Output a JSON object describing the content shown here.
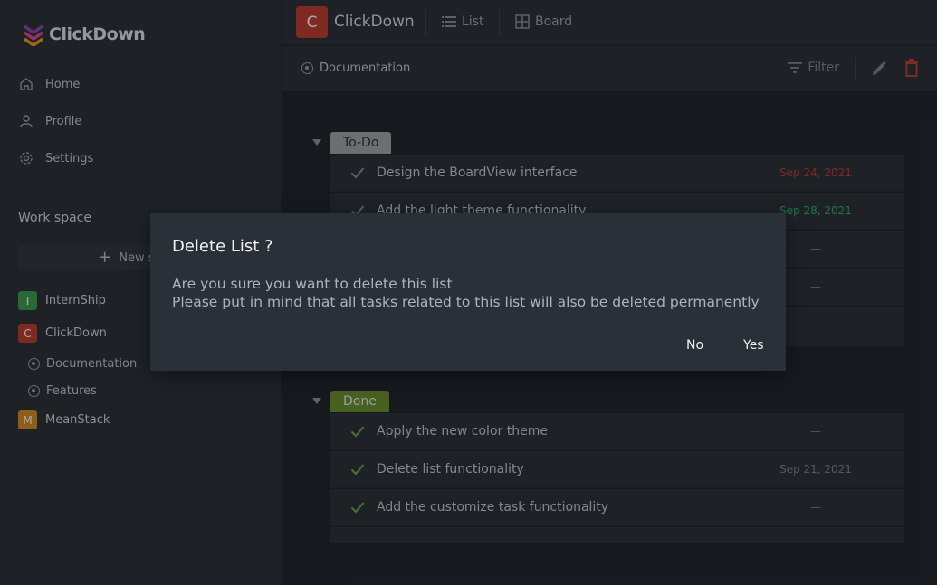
{
  "app": {
    "name": "ClickDown"
  },
  "sidebar": {
    "nav": [
      {
        "label": "Home",
        "icon": "home-icon"
      },
      {
        "label": "Profile",
        "icon": "user-icon"
      },
      {
        "label": "Settings",
        "icon": "gear-icon"
      }
    ],
    "workspace_title": "Work space",
    "new_space_label": "New space",
    "spaces": [
      {
        "letter": "I",
        "name": "InternShip",
        "color": "#3d9a4a"
      },
      {
        "letter": "C",
        "name": "ClickDown",
        "color": "#c0392b"
      },
      {
        "letter": "M",
        "name": "MeanStack",
        "color": "#d68a1f"
      }
    ],
    "lists": [
      "Documentation",
      "Features"
    ]
  },
  "topbar": {
    "project_letter": "C",
    "project_name": "ClickDown",
    "tabs": [
      "List",
      "Board"
    ]
  },
  "subbar": {
    "breadcrumb": "Documentation",
    "filter_label": "Filter"
  },
  "groups": [
    {
      "name": "To-Do",
      "tag_bg": "#a3a3a3",
      "tag_fg": "#2b2b2b",
      "tasks": [
        {
          "title": "Design the BoardView interface",
          "date": "Sep 24, 2021",
          "date_color": "red"
        },
        {
          "title": "Add the light theme functionality",
          "date": "Sep 28, 2021",
          "date_color": "green"
        },
        {
          "title": "",
          "date": "—",
          "date_color": "grey"
        },
        {
          "title": "",
          "date": "—",
          "date_color": "grey"
        },
        {
          "title": "",
          "date": "",
          "date_color": "grey"
        }
      ]
    },
    {
      "name": "Done",
      "tag_bg": "#6a8f2c",
      "tag_fg": "#e8eedf",
      "tasks": [
        {
          "title": "Apply the new color theme",
          "date": "—",
          "date_color": "grey"
        },
        {
          "title": "Delete list functionality",
          "date": "Sep 21, 2021",
          "date_color": "grey"
        },
        {
          "title": "Add the customize task functionality",
          "date": "—",
          "date_color": "grey"
        },
        {
          "title": "",
          "date": "",
          "date_color": "grey"
        }
      ]
    }
  ],
  "modal": {
    "title": "Delete List ?",
    "line1": "Are you sure you want to delete this list",
    "line2": "Please put in mind that all tasks related to this list will also be deleted permanently",
    "no_label": "No",
    "yes_label": "Yes"
  }
}
